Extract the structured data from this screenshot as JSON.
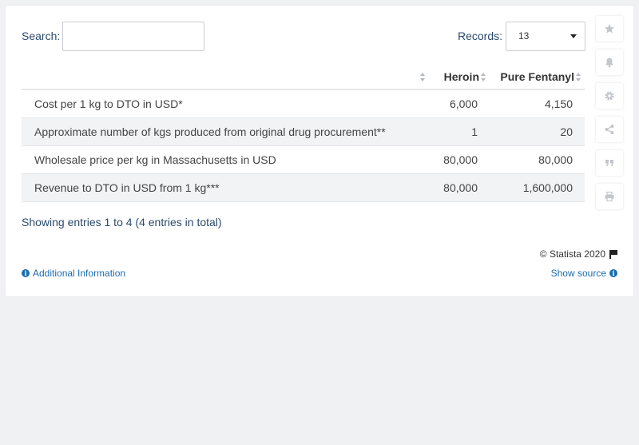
{
  "search": {
    "label": "Search:",
    "value": ""
  },
  "records": {
    "label": "Records:",
    "selected": "13"
  },
  "table": {
    "columns": [
      "",
      "Heroin",
      "Pure Fentanyl"
    ],
    "rows": [
      {
        "label": "Cost per 1 kg to DTO in USD*",
        "heroin": "6,000",
        "fentanyl": "4,150"
      },
      {
        "label": "Approximate number of kgs produced from original drug procurement**",
        "heroin": "1",
        "fentanyl": "20"
      },
      {
        "label": "Wholesale price per kg in Massachusetts in USD",
        "heroin": "80,000",
        "fentanyl": "80,000"
      },
      {
        "label": "Revenue to DTO in USD from 1 kg***",
        "heroin": "80,000",
        "fentanyl": "1,600,000"
      }
    ]
  },
  "footer": {
    "entries_info": "Showing entries 1 to 4 (4 entries in total)",
    "copyright": "© Statista 2020",
    "additional_info": "Additional Information",
    "show_source": "Show source"
  },
  "sidebar_icons": [
    "star-icon",
    "bell-icon",
    "gear-icon",
    "share-icon",
    "quote-icon",
    "print-icon"
  ],
  "colors": {
    "link": "#1b6cb0",
    "label": "#2b4a6b",
    "row_alt": "#f1f3f5"
  },
  "chart_data": {
    "type": "table",
    "columns": [
      "",
      "Heroin",
      "Pure Fentanyl"
    ],
    "rows": [
      [
        "Cost per 1 kg to DTO in USD*",
        6000,
        4150
      ],
      [
        "Approximate number of kgs produced from original drug procurement**",
        1,
        20
      ],
      [
        "Wholesale price per kg in Massachusetts in USD",
        80000,
        80000
      ],
      [
        "Revenue to DTO in USD from 1 kg***",
        80000,
        1600000
      ]
    ]
  }
}
